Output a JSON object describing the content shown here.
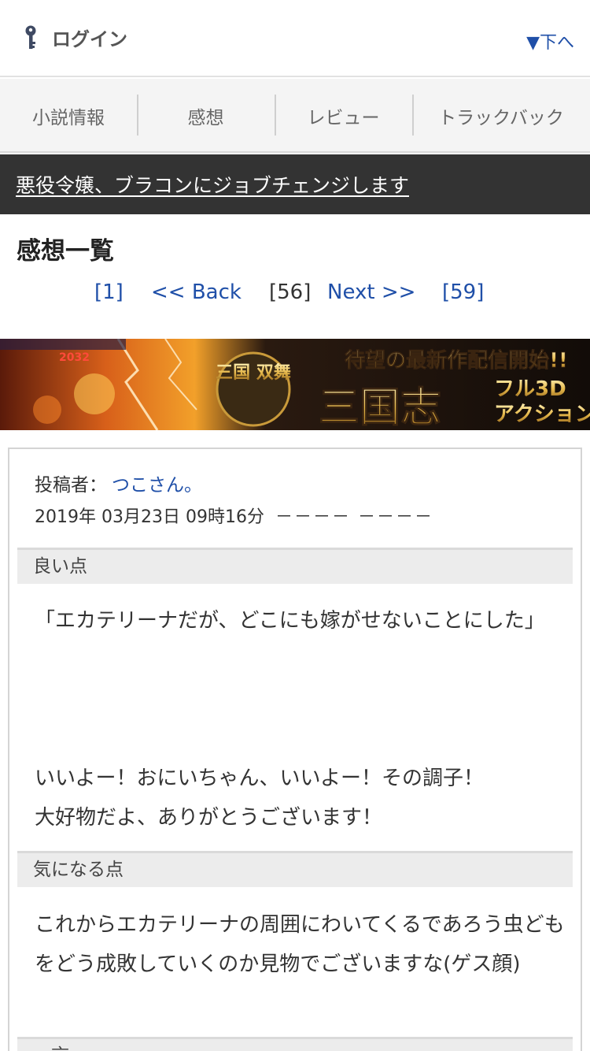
{
  "header": {
    "login_label": "ログイン",
    "to_bottom_label": "▼下へ",
    "login_icon": "key-icon"
  },
  "tabs": [
    {
      "label": "小説情報"
    },
    {
      "label": "感想"
    },
    {
      "label": "レビュー"
    },
    {
      "label": "トラックバック"
    }
  ],
  "novel_title": "悪役令嬢、ブラコンにジョブチェンジします",
  "page_heading": "感想一覧",
  "pager": {
    "first": "[1]",
    "back": "<< Back",
    "current": "[56]",
    "next": "Next >>",
    "last": "[59]"
  },
  "banner": {
    "headline": "待望の最新作配信開始!!",
    "game_logo": "三国 双舞",
    "title_main": "三国志",
    "title_sub_1": "フル3D",
    "title_sub_2": "アクション",
    "tag": "2032"
  },
  "comment": {
    "poster_label": "投稿者：",
    "author": "つこさん。",
    "date": "2019年 03月23日 09時16分",
    "rating": "－－－－ －－－－",
    "good_label": "良い点",
    "good_text_1": "「エカテリーナだが、どこにも嫁がせないことにした」",
    "good_text_2a": "いいよー！おにいちゃん、いいよー！その調子！",
    "good_text_2b": "大好物だよ、ありがとうございます！",
    "concern_label": "気になる点",
    "concern_text": "これからエカテリーナの周囲にわいてくるであろう虫どもをどう成敗していくのか見物でございますな(ゲス顔)",
    "third_label": "一言"
  },
  "colors": {
    "link": "#1f4fa8",
    "title_bar": "#333333",
    "section_bg": "#ececec"
  }
}
